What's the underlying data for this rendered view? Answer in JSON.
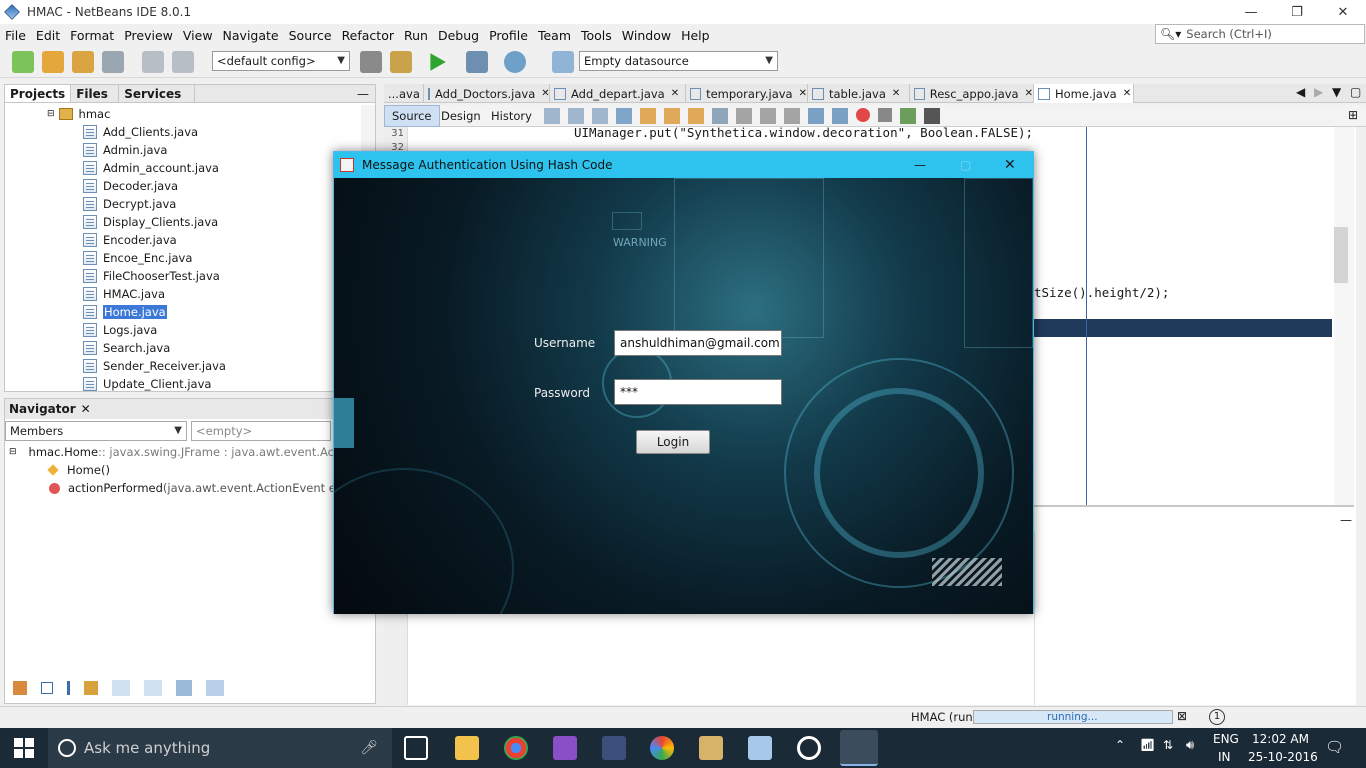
{
  "window": {
    "title": "HMAC - NetBeans IDE 8.0.1",
    "minimize": "—",
    "restore": "❐",
    "close": "✕"
  },
  "menu": [
    "File",
    "Edit",
    "Format",
    "Preview",
    "View",
    "Navigate",
    "Source",
    "Refactor",
    "Run",
    "Debug",
    "Profile",
    "Team",
    "Tools",
    "Window",
    "Help"
  ],
  "search": {
    "placeholder": "Search (Ctrl+I)"
  },
  "toolbar": {
    "config": "<default config>",
    "datasource": "Empty datasource"
  },
  "projects": {
    "tabs": [
      "Projects",
      "Files",
      "Services"
    ],
    "folder": "hmac",
    "files": [
      "Add_Clients.java",
      "Admin.java",
      "Admin_account.java",
      "Decoder.java",
      "Decrypt.java",
      "Display_Clients.java",
      "Encoder.java",
      "Encoe_Enc.java",
      "FileChooserTest.java",
      "HMAC.java",
      "Home.java",
      "Logs.java",
      "Search.java",
      "Sender_Receiver.java",
      "Update_Client.java"
    ],
    "selected": "Home.java"
  },
  "navigator": {
    "title": "Navigator",
    "members": "Members",
    "filter": "<empty>",
    "class_name": "hmac.Home",
    "class_sig": " :: javax.swing.JFrame : java.awt.event.ActionListener",
    "constructor": "Home()",
    "method_name": "actionPerformed",
    "method_params": "(java.awt.event.ActionEvent e)"
  },
  "editor": {
    "tabs": [
      "...ava",
      "Add_Doctors.java",
      "Add_depart.java",
      "temporary.java",
      "table.java",
      "Resc_appo.java",
      "Home.java"
    ],
    "active_tab": "Home.java",
    "modes": [
      "Source",
      "Design",
      "History"
    ],
    "line_numbers": [
      "31",
      "32"
    ],
    "code_line1": "UIManager.put(\"Synthetica.window.decoration\", Boolean.FALSE);",
    "code_line2": "tSize().height/2);"
  },
  "status": {
    "project": "HMAC (run)",
    "progress": "running...",
    "progress_fraction": 1.0,
    "notifications": "1"
  },
  "dialog": {
    "title": "Message Authentication Using Hash Code",
    "warning": "WARNING",
    "username_label": "Username",
    "username_value": "anshuldhiman@gmail.com",
    "password_label": "Password",
    "password_value": "***",
    "login": "Login"
  },
  "taskbar": {
    "search": "Ask me anything",
    "lang1": "ENG",
    "lang2": "IN",
    "time": "12:02 AM",
    "date": "25-10-2016"
  }
}
